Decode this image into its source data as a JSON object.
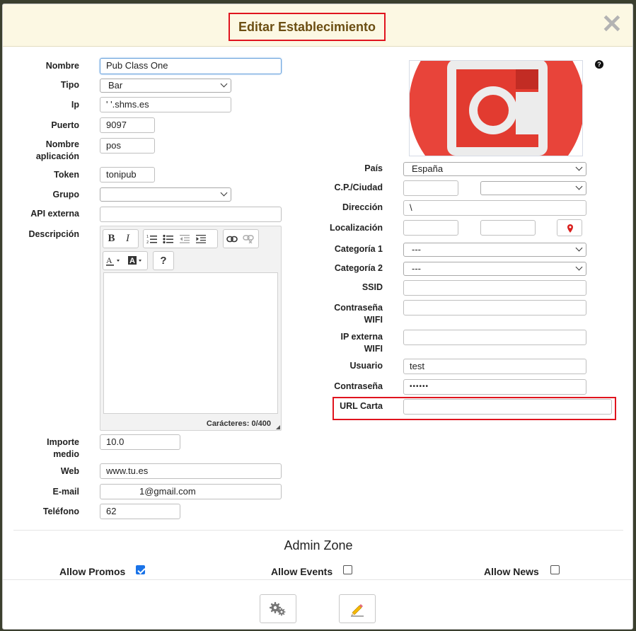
{
  "dialog": {
    "title": "Editar Establecimiento",
    "close_glyph": "✕"
  },
  "left_form": {
    "nombre": {
      "label": "Nombre",
      "value": "Pub Class One"
    },
    "tipo": {
      "label": "Tipo",
      "value": "Bar"
    },
    "ip": {
      "label": "Ip",
      "value": "' '.shms.es"
    },
    "puerto": {
      "label": "Puerto",
      "value": "9097"
    },
    "nombre_aplicacion": {
      "label_line1": "Nombre",
      "label_line2": "aplicación",
      "value": "pos"
    },
    "token": {
      "label": "Token",
      "value": "tonipub"
    },
    "grupo": {
      "label": "Grupo",
      "value": ""
    },
    "api_externa": {
      "label": "API externa",
      "value": ""
    },
    "descripcion": {
      "label": "Descripción",
      "char_count": "Carácteres: 0/400"
    },
    "importe_medio": {
      "label_line1": "Importe",
      "label_line2": "medio",
      "value": "10.0"
    },
    "web": {
      "label": "Web",
      "value": "www.tu.es"
    },
    "email": {
      "label": "E-mail",
      "value": "1@gmail.com"
    },
    "telefono": {
      "label": "Teléfono",
      "value": "62"
    }
  },
  "editor_toolbar": {
    "bold": "B",
    "italic": "I",
    "help": "?"
  },
  "right_form": {
    "help_glyph": "?",
    "pais": {
      "label": "País",
      "value": "España"
    },
    "cp_ciudad": {
      "label": "C.P./Ciudad",
      "cp": "",
      "ciudad": ""
    },
    "direccion": {
      "label": "Dirección",
      "value": "\\"
    },
    "localizacion": {
      "label": "Localización",
      "lat": "",
      "lng": ""
    },
    "categoria1": {
      "label": "Categoría 1",
      "value": "---"
    },
    "categoria2": {
      "label": "Categoría 2",
      "value": "---"
    },
    "ssid": {
      "label": "SSID",
      "value": ""
    },
    "contrasena_wifi": {
      "label_line1": "Contraseña",
      "label_line2": "WIFI",
      "value": ""
    },
    "ip_externa_wifi": {
      "label_line1": "IP externa",
      "label_line2": "WIFI",
      "value": ""
    },
    "usuario": {
      "label": "Usuario",
      "value": "test"
    },
    "contrasena": {
      "label": "Contraseña",
      "value": "••••••"
    },
    "url_carta": {
      "label": "URL Carta",
      "value": ""
    }
  },
  "admin_zone": {
    "title": "Admin Zone",
    "allow_promos": {
      "label": "Allow Promos",
      "checked": true
    },
    "allow_events": {
      "label": "Allow Events",
      "checked": false
    },
    "allow_news": {
      "label": "Allow News",
      "checked": false
    }
  },
  "colors": {
    "header_bg": "#fcf8e3",
    "title_color": "#6b4e12",
    "highlight": "#e0141e",
    "photo_red": "#e8443a"
  }
}
